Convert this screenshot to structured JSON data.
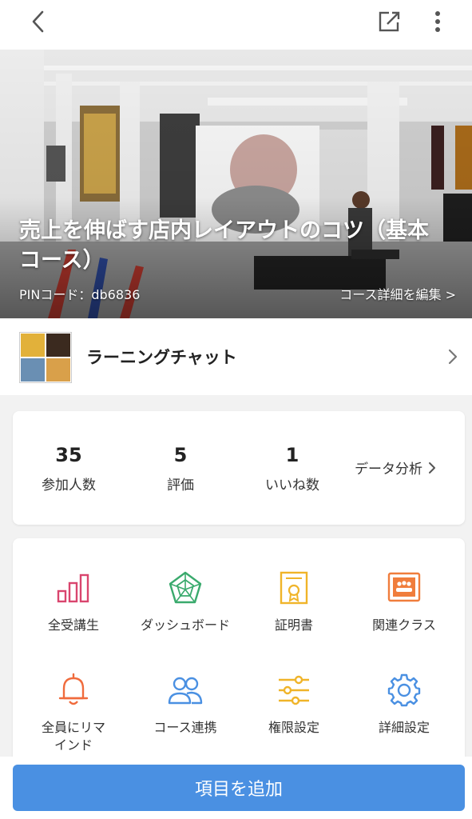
{
  "nav": {
    "back_icon": "chevron-left-icon",
    "share_icon": "external-link-icon",
    "more_icon": "more-vertical-icon"
  },
  "hero": {
    "title": "売上を伸ばす店内レイアウトのコツ（基本コース）",
    "pin": "PINコード：db6836",
    "edit_link": "コース詳細を編集 >"
  },
  "chat": {
    "label": "ラーニングチャット",
    "chevron_icon": "chevron-right-icon"
  },
  "stats": {
    "participants": {
      "value": "35",
      "label": "参加人数"
    },
    "ratings": {
      "value": "5",
      "label": "評価"
    },
    "likes": {
      "value": "1",
      "label": "いいね数"
    },
    "analysis_label": "データ分析"
  },
  "menu": {
    "items": [
      {
        "label": "全受講生",
        "icon": "bar-chart-icon",
        "color": "#d9456e"
      },
      {
        "label": "ダッシュボード",
        "icon": "radar-chart-icon",
        "color": "#3aaa6d"
      },
      {
        "label": "証明書",
        "icon": "certificate-icon",
        "color": "#f0b429"
      },
      {
        "label": "関連クラス",
        "icon": "class-group-icon",
        "color": "#f07d3c"
      },
      {
        "label": "全員にリマインド",
        "icon": "bell-icon",
        "color": "#f06b3c"
      },
      {
        "label": "コース連携",
        "icon": "users-icon",
        "color": "#4a90e2"
      },
      {
        "label": "権限設定",
        "icon": "sliders-icon",
        "color": "#f0b429"
      },
      {
        "label": "詳細設定",
        "icon": "gear-icon",
        "color": "#4a90e2"
      }
    ]
  },
  "footer": {
    "add_button_label": "項目を追加"
  },
  "colors": {
    "accent": "#4a90e2"
  }
}
